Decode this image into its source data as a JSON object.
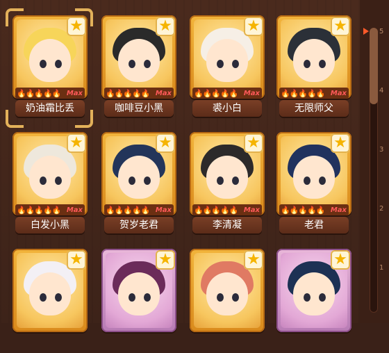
{
  "cards": [
    {
      "name": "奶油霜比丢",
      "max_label": "Max",
      "hair": "#f7d55a",
      "tone": "gold",
      "selected": true
    },
    {
      "name": "咖啡豆小黑",
      "max_label": "Max",
      "hair": "#2a2a2a",
      "tone": "gold"
    },
    {
      "name": "裘小白",
      "max_label": "Max",
      "hair": "#f6efe6",
      "tone": "gold"
    },
    {
      "name": "无限师父",
      "max_label": "Max",
      "hair": "#2b3038",
      "tone": "gold"
    },
    {
      "name": "白发小黑",
      "max_label": "Max",
      "hair": "#eee8dc",
      "tone": "gold"
    },
    {
      "name": "贺岁老君",
      "max_label": "Max",
      "hair": "#23355a",
      "tone": "gold"
    },
    {
      "name": "李清凝",
      "max_label": "Max",
      "hair": "#2c2a2a",
      "tone": "gold"
    },
    {
      "name": "老君",
      "max_label": "Max",
      "hair": "#21325e",
      "tone": "gold"
    },
    {
      "name": "",
      "max_label": "",
      "hair": "#f3f0f5",
      "tone": "gold"
    },
    {
      "name": "",
      "max_label": "",
      "hair": "#6b2b5a",
      "tone": "purple"
    },
    {
      "name": "",
      "max_label": "",
      "hair": "#e07a63",
      "tone": "gold"
    },
    {
      "name": "",
      "max_label": "",
      "hair": "#1d3154",
      "tone": "purple"
    }
  ],
  "icons": {
    "star": "star-icon",
    "flame": "flame-icon"
  },
  "flame_glyphs": "🔥🔥🔥🔥🔥",
  "star_glyph": "★",
  "scroll_ticks": [
    "5",
    "4",
    "3",
    "2",
    "1"
  ],
  "scroll_position": 0.0
}
